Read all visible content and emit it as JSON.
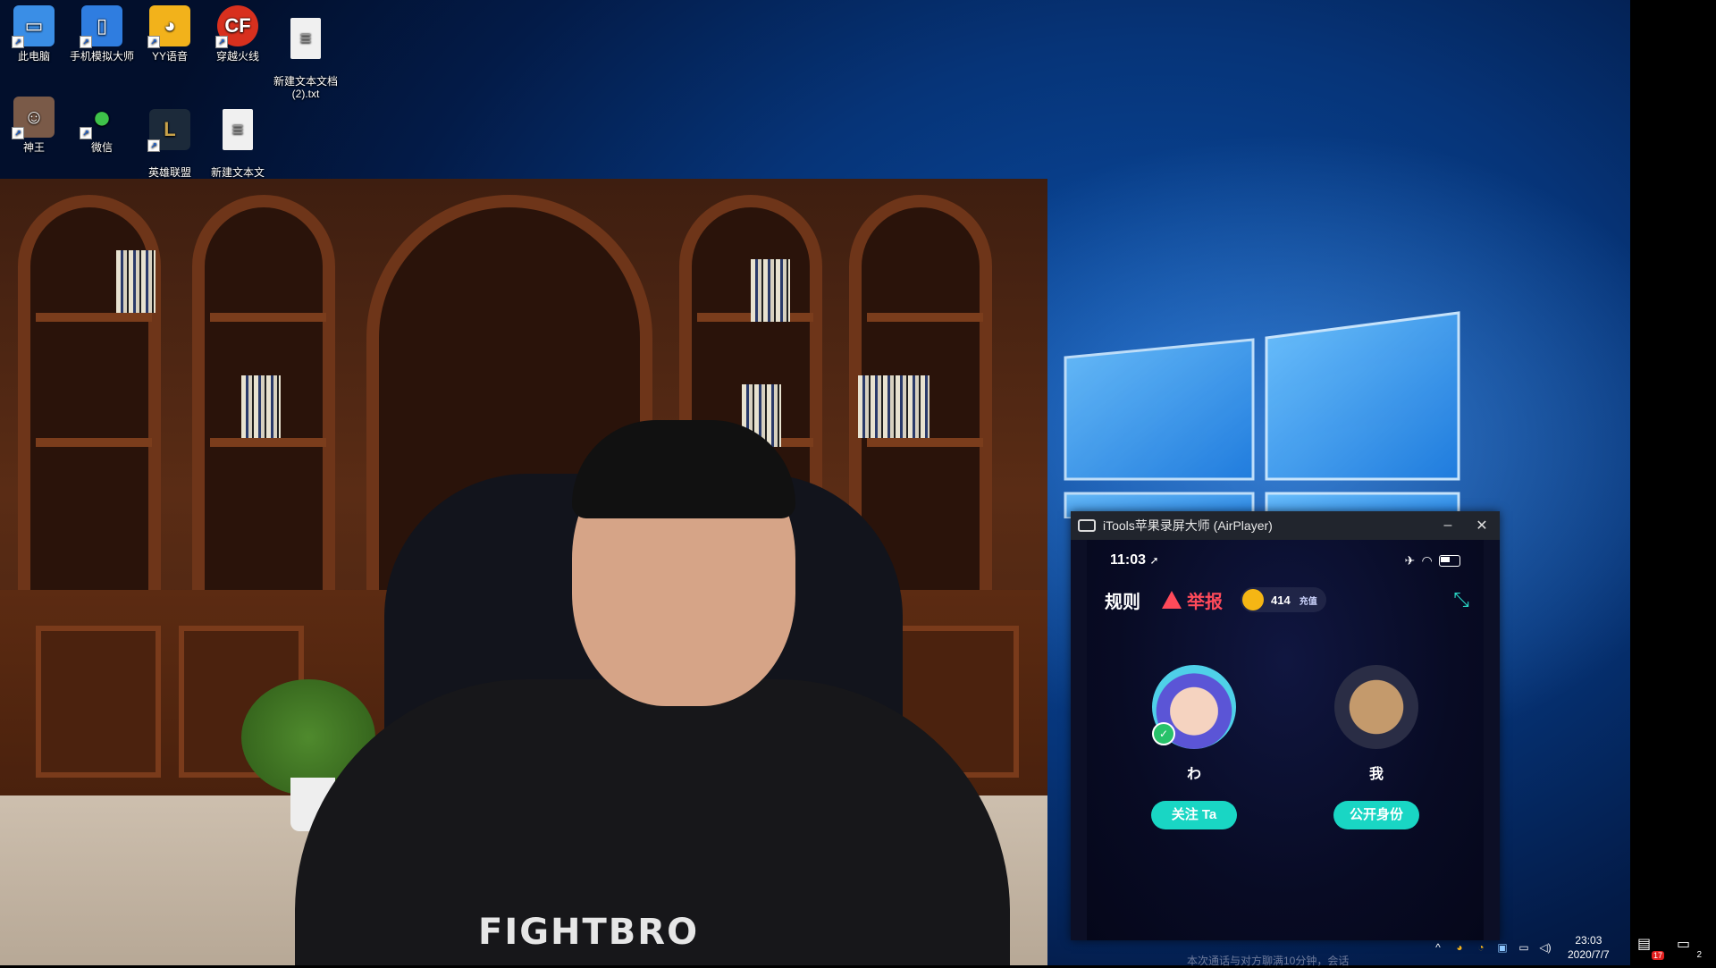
{
  "desktop": {
    "icons_row1": [
      {
        "label": "此电脑",
        "icon": "computer-icon",
        "color": "#3a8ee6"
      },
      {
        "label": "手机模拟大师",
        "icon": "phone-emulator-icon",
        "color": "#2f7de0"
      },
      {
        "label": "YY语音",
        "icon": "yy-voice-icon",
        "color": "#f2b21b"
      },
      {
        "label": "穿越火线",
        "icon": "crossfire-icon",
        "color": "#d8301e"
      },
      {
        "label": "新建文本文档\n(2).txt",
        "icon": "text-file-icon",
        "color": "#f0f0f0"
      }
    ],
    "icons_row2": [
      {
        "label": "神王",
        "icon": "game-god-king-icon",
        "color": "#7a5a48"
      },
      {
        "label": "微信",
        "icon": "wechat-icon",
        "color": "#3ec24a"
      },
      {
        "label": "英雄联盟\nWeGame版",
        "icon": "league-of-legends-icon",
        "color": "#c8a24a"
      },
      {
        "label": "新建文本文\n档.txt",
        "icon": "text-file-icon",
        "color": "#f0f0f0"
      }
    ]
  },
  "webcam": {
    "shirt_text": "FIGHTBRO"
  },
  "itools_window": {
    "title": "iTools苹果录屏大师 (AirPlayer)",
    "minimize_glyph": "–",
    "close_glyph": "✕",
    "phone": {
      "time": "11:03",
      "location_glyph": "➚",
      "airplane_glyph": "✈",
      "wifi_glyph": "◠",
      "rules_label": "规则",
      "report_label": "举报",
      "coins": "414",
      "recharge_label": "充值",
      "shrink_glyph": "⤡",
      "left_user": {
        "name": "わ",
        "button": "关注 Ta"
      },
      "right_user": {
        "name": "我",
        "button": "公开身份"
      },
      "accent_color": "#19d6c4",
      "report_color": "#ff4a5a"
    }
  },
  "taskbar": {
    "tray_up_glyph": "^",
    "time": "23:03",
    "date": "2020/7/7",
    "notification_count": "17",
    "action_center_count": "2",
    "caption_overlay": "本次通话与对方聊满10分钟，会话"
  }
}
